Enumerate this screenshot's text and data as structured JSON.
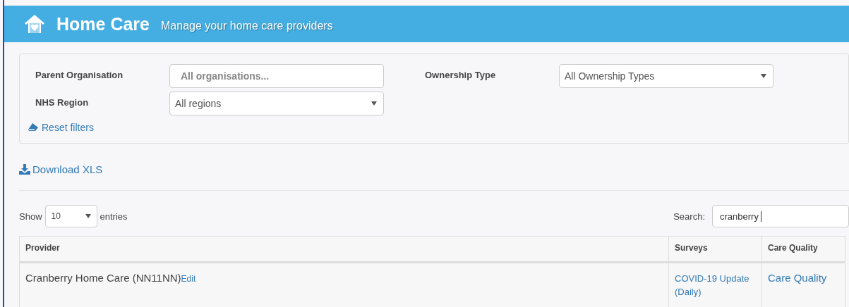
{
  "header": {
    "title": "Home Care",
    "subtitle": "Manage your home care providers"
  },
  "filters": [
    {
      "kind": "text",
      "label": "Parent Organisation",
      "placeholder": "All organisations..."
    },
    {
      "kind": "select",
      "label": "Ownership Type",
      "value": "All Ownership Types"
    },
    {
      "kind": "select",
      "label": "NHS Region",
      "value": "All regions"
    }
  ],
  "reset_filters": "Reset filters",
  "download": "Download XLS",
  "length": {
    "before": "Show",
    "value": "10",
    "after": "entries"
  },
  "search": {
    "label": "Search:",
    "value": "cranberry"
  },
  "table": {
    "columns": [
      "Provider",
      "Surveys",
      "Care Quality"
    ],
    "rows": [
      {
        "provider": "Cranberry Home Care (NN11NN)",
        "edit": "Edit",
        "survey": "COVID-19 Update (Daily)",
        "quality": "Care Quality"
      }
    ]
  }
}
